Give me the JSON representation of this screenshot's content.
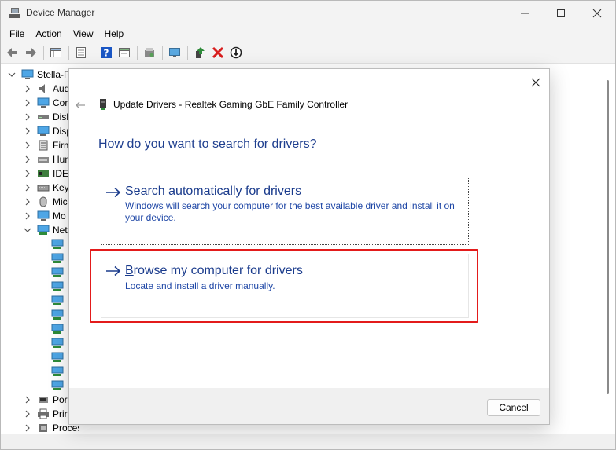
{
  "window": {
    "title": "Device Manager",
    "controls": {
      "minimize": "minimize",
      "maximize": "maximize",
      "close": "close"
    }
  },
  "menu": [
    "File",
    "Action",
    "View",
    "Help"
  ],
  "toolbar": {
    "icons": [
      "back-arrow-icon",
      "forward-arrow-icon",
      "properties-grid-icon",
      "list-view-icon",
      "help-icon",
      "details-icon",
      "scan-hardware-icon",
      "monitor-icon",
      "update-driver-icon",
      "uninstall-x-icon",
      "disable-device-icon"
    ],
    "colors": {
      "help": "#1a56c4",
      "uninstall": "#d81e1e",
      "update": "#2e8b3a"
    }
  },
  "tree": {
    "root": "Stella-P",
    "categories": [
      {
        "label": "Aud",
        "icon": "speaker-icon",
        "expanded": false
      },
      {
        "label": "Cor",
        "icon": "computer-icon",
        "expanded": false
      },
      {
        "label": "Disk",
        "icon": "disk-drive-icon",
        "expanded": false
      },
      {
        "label": "Disp",
        "icon": "display-adapter-icon",
        "expanded": false
      },
      {
        "label": "Firm",
        "icon": "firmware-icon",
        "expanded": false
      },
      {
        "label": "Hun",
        "icon": "hid-icon",
        "expanded": false
      },
      {
        "label": "IDE",
        "icon": "ide-controller-icon",
        "expanded": false
      },
      {
        "label": "Key",
        "icon": "keyboard-icon",
        "expanded": false
      },
      {
        "label": "Mic",
        "icon": "mouse-icon",
        "expanded": false
      },
      {
        "label": "Mo",
        "icon": "monitor-icon",
        "expanded": false
      },
      {
        "label": "Net",
        "icon": "network-adapter-icon",
        "expanded": true
      }
    ],
    "network_children_count": 11,
    "bottom_categories": [
      {
        "label": "Por",
        "icon": "port-icon"
      },
      {
        "label": "Prir",
        "icon": "printer-icon"
      },
      {
        "label": "Processors",
        "icon": "processor-icon"
      }
    ]
  },
  "dialog": {
    "title": "Update Drivers - Realtek Gaming GbE Family Controller",
    "heading": "How do you want to search for drivers?",
    "options": [
      {
        "title_first": "S",
        "title_rest": "earch automatically for drivers",
        "description": "Windows will search your computer for the best available driver and install it on your device."
      },
      {
        "title_first": "B",
        "title_rest": "rowse my computer for drivers",
        "description": "Locate and install a driver manually."
      }
    ],
    "cancel_label": "Cancel",
    "highlight_color": "#e31b1b",
    "accent_color": "#1a3b8c"
  }
}
